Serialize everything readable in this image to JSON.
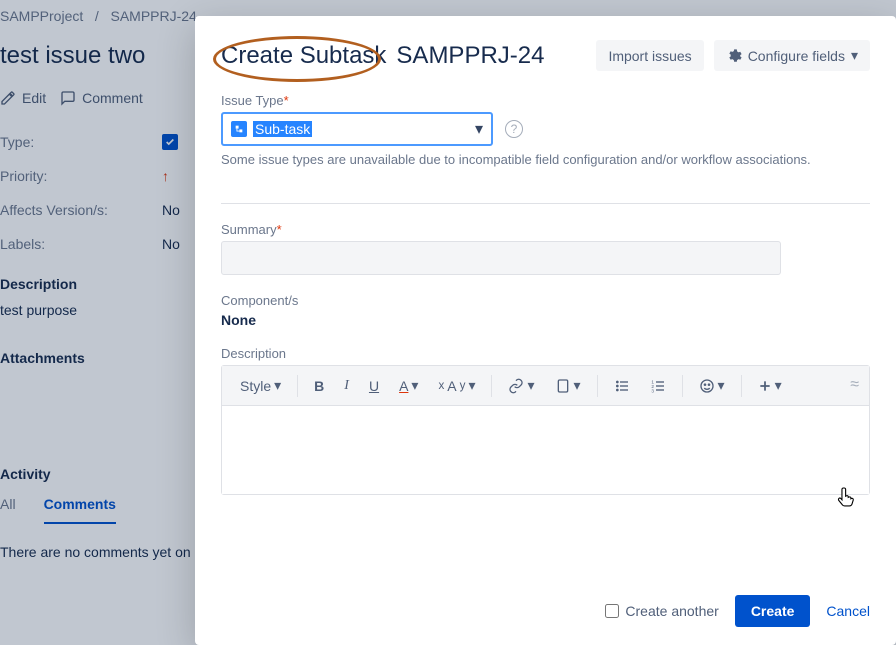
{
  "breadcrumb": {
    "project": "SAMPProject",
    "issue": "SAMPPRJ-24",
    "sep": "/"
  },
  "bg": {
    "title": "test issue two",
    "edit": "Edit",
    "comment": "Comment",
    "type_lbl": "Type:",
    "priority_lbl": "Priority:",
    "affects_lbl": "Affects Version/s:",
    "labels_lbl": "Labels:",
    "affects_val": "No",
    "labels_val": "No",
    "desc_h": "Description",
    "desc_text": "test purpose",
    "attach_h": "Attachments",
    "activity_h": "Activity",
    "tab_all": "All",
    "tab_comments": "Comments",
    "empty_comments": "There are no comments yet on"
  },
  "modal": {
    "title": "Create Subtask",
    "issue_key": "SAMPPRJ-24",
    "import_btn": "Import issues",
    "configure_btn": "Configure fields",
    "issue_type_label": "Issue Type",
    "issue_type_value": "Sub-task",
    "issue_type_hint": "Some issue types are unavailable due to incompatible field configuration and/or workflow associations.",
    "summary_label": "Summary",
    "components_label": "Component/s",
    "components_value": "None",
    "description_label": "Description",
    "rte": {
      "style": "Style",
      "bold": "B",
      "italic": "I",
      "underline": "U",
      "textcolor": "A"
    },
    "create_another": "Create another",
    "create_btn": "Create",
    "cancel_btn": "Cancel"
  }
}
